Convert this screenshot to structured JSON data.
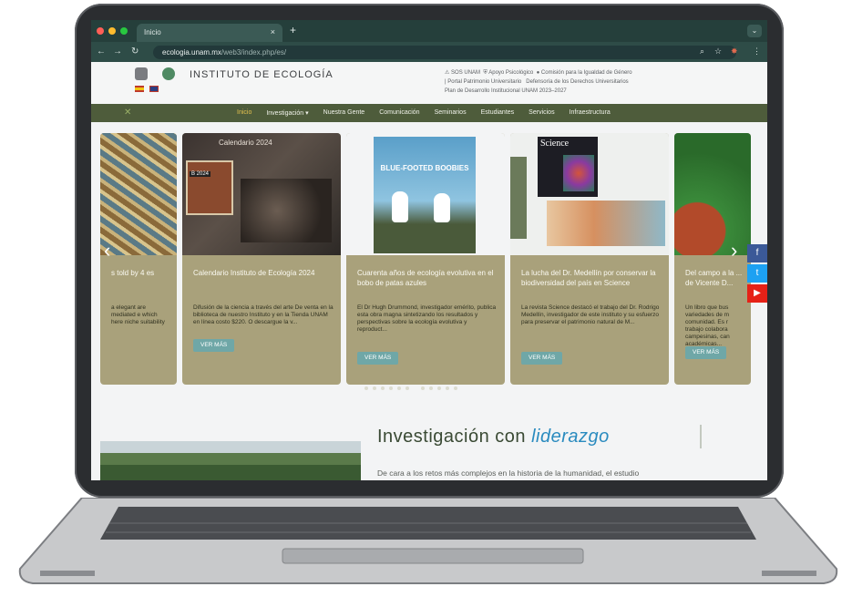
{
  "browser": {
    "tab_title": "Inicio",
    "tab_close": "×",
    "new_tab": "+",
    "url_host": "ecologia.unam.mx",
    "url_path": "/web3/index.php/es/",
    "menu": "⌄"
  },
  "site": {
    "title": "INSTITUTO DE ECOLOGÍA",
    "top_links": [
      "⚠ SOS UNAM",
      "⛨ Apoyo Psicológico",
      "● Comisión para la Igualdad de Género",
      "| Portal Patrimonio Universitario",
      "Defensoría de los Derechos Universitarios",
      "Plan de Desarrollo Institucional UNAM 2023–2027"
    ]
  },
  "nav": {
    "items": [
      "Inicio",
      "Investigación ▾",
      "Nuestra Gente",
      "Comunicación",
      "Seminarios",
      "Estudiantes",
      "Servicios",
      "Infraestructura"
    ]
  },
  "carousel": {
    "cards": [
      {
        "title": "s told by 4 es",
        "body": "a elegant are mediated e which here niche suitability",
        "button": ""
      },
      {
        "title": "Calendario Instituto de Ecología 2024",
        "body": "Difusión de la ciencia a través del arte De venta en la biblioteca de nuestro Instituto y en la Tienda UNAM en línea costo $220. O descargue la v...",
        "button": "VER MÁS",
        "image_caption": "Calendario 2024",
        "image_badge": "B 2024"
      },
      {
        "title": "Cuarenta años de ecología evolutiva en el bobo de patas azules",
        "body": "El Dr Hugh Drummond, investigador emérito, publica esta obra magna sintetizando los resultados y perspectivas sobre la ecología evolutiva y reproduct...",
        "button": "VER MÁS",
        "image_caption": "BLUE-FOOTED BOOBIES"
      },
      {
        "title": "La lucha del Dr. Medellín por conservar la biodiversidad del país en Science",
        "body": "La revista Science destacó el trabajo del Dr. Rodrigo Medellín, investigador de este instituto y su esfuerzo para preservar el patrimonio natural de M...",
        "button": "VER MÁS",
        "image_caption": "Science"
      },
      {
        "title": "Del campo a la ... de Vicente D...",
        "body": "Un libro que bus variedades de m comunidad. Es r trabajo colabora campesinas, can académicas...",
        "button": "VER MÁS"
      }
    ],
    "prev": "‹",
    "next": "›"
  },
  "social": {
    "facebook": "f",
    "twitter": "t",
    "youtube": "▶"
  },
  "section": {
    "heading_plain": "Investigación con",
    "heading_em": "liderazgo",
    "paragraph": "De cara a los retos más complejos en la historia de la humanidad, el estudio"
  },
  "colors": {
    "nav": "#4e5c3b",
    "card": "#a9a17b",
    "button": "#6fa7a7",
    "accent": "#2a8bbf"
  }
}
